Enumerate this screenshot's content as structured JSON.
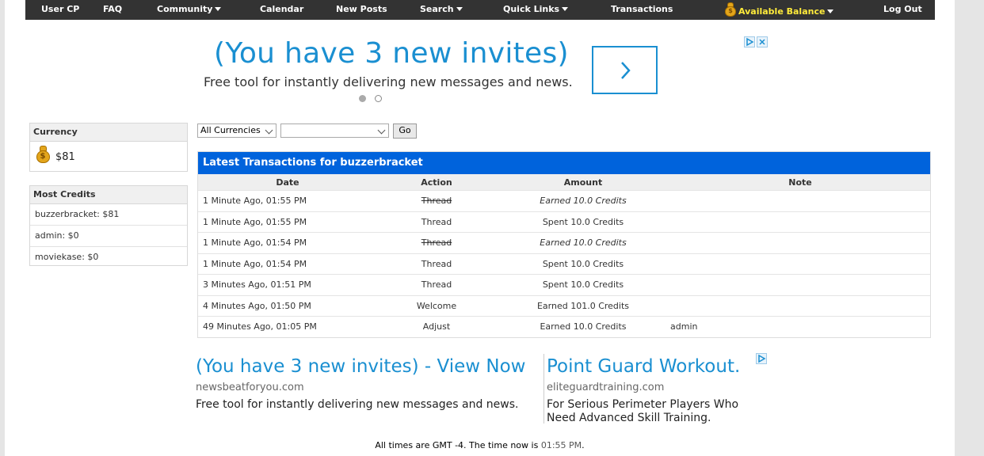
{
  "nav": {
    "user_cp": "User CP",
    "faq": "FAQ",
    "community": "Community",
    "calendar": "Calendar",
    "new_posts": "New Posts",
    "search": "Search",
    "quick_links": "Quick Links",
    "transactions": "Transactions",
    "available_balance": "Available Balance",
    "log_out": "Log Out"
  },
  "ad_top": {
    "headline": "(You have 3 new invites)",
    "description": "Free tool for instantly delivering new messages and news."
  },
  "sidebar": {
    "currency": {
      "title": "Currency",
      "value": "$81"
    },
    "most_credits": {
      "title": "Most Credits",
      "items": [
        "buzzerbracket: $81",
        "admin: $0",
        "moviekase: $0"
      ]
    }
  },
  "filter": {
    "currency_select": "All Currencies",
    "second_select": "",
    "go_label": "Go"
  },
  "transactions": {
    "title": "Latest Transactions for buzzerbracket",
    "headers": {
      "date": "Date",
      "action": "Action",
      "amount": "Amount",
      "note": "Note"
    },
    "rows": [
      {
        "date": "1 Minute Ago, 01:55 PM",
        "action": "Thread",
        "amount": "Earned 10.0 Credits",
        "note": ""
      },
      {
        "date": "1 Minute Ago, 01:55 PM",
        "action": "Thread",
        "amount": "Spent 10.0 Credits",
        "note": ""
      },
      {
        "date": "1 Minute Ago, 01:54 PM",
        "action": "Thread",
        "amount": "Earned 10.0 Credits",
        "note": ""
      },
      {
        "date": "1 Minute Ago, 01:54 PM",
        "action": "Thread",
        "amount": "Spent 10.0 Credits",
        "note": ""
      },
      {
        "date": "3 Minutes Ago, 01:51 PM",
        "action": "Thread",
        "amount": "Spent 10.0 Credits",
        "note": ""
      },
      {
        "date": "4 Minutes Ago, 01:50 PM",
        "action": "Welcome",
        "amount": "Earned 101.0 Credits",
        "note": ""
      },
      {
        "date": "49 Minutes Ago, 01:05 PM",
        "action": "Adjust",
        "amount": "Earned 10.0 Credits",
        "note": "admin"
      }
    ]
  },
  "ad_bottom_left": {
    "title": "(You have 3 new invites) - View Now",
    "url": "newsbeatforyou.com",
    "description": "Free tool for instantly delivering new messages and news."
  },
  "ad_bottom_right": {
    "title": "Point Guard Workout.",
    "url": "eliteguardtraining.com",
    "description": "For Serious Perimeter Players Who Need Advanced Skill Training."
  },
  "footer": {
    "prefix": "All times are GMT -4. The time now is",
    "time": "01:55 PM",
    "suffix": "."
  },
  "colors": {
    "nav_bg": "#333333",
    "table_header_bg": "#0063dc",
    "ad_link": "#1a8fd1",
    "balance_text": "#ffeb3b"
  }
}
